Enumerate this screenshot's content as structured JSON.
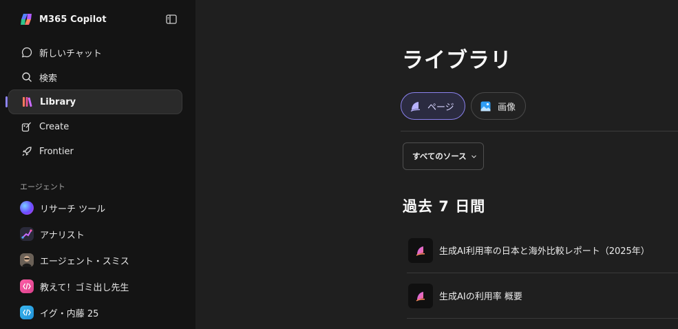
{
  "app": {
    "name": "M365 Copilot"
  },
  "sidebar": {
    "nav": [
      {
        "label": "新しいチャット",
        "icon": "chat-bubble-icon"
      },
      {
        "label": "検索",
        "icon": "search-icon"
      },
      {
        "label": "Library",
        "icon": "library-icon",
        "active": true
      },
      {
        "label": "Create",
        "icon": "create-icon"
      },
      {
        "label": "Frontier",
        "icon": "rocket-icon"
      }
    ],
    "agents_label": "エージェント",
    "agents": [
      {
        "label": "リサーチ ツール",
        "icon": "research-agent-icon"
      },
      {
        "label": "アナリスト",
        "icon": "analyst-agent-icon"
      },
      {
        "label": "エージェント・スミス",
        "icon": "agent-smith-avatar"
      },
      {
        "label": "教えて！ゴミ出し先生",
        "icon": "gomi-agent-icon"
      },
      {
        "label": "イグ・内藤 25",
        "icon": "ig-naito-agent-icon"
      }
    ]
  },
  "main": {
    "title": "ライブラリ",
    "tabs": [
      {
        "label": "ページ",
        "icon": "pages-icon",
        "selected": true
      },
      {
        "label": "画像",
        "icon": "image-icon",
        "selected": false
      }
    ],
    "filter": {
      "label": "すべてのソース"
    },
    "section": "過去 7 日間",
    "documents": [
      {
        "title": "生成AI利用率の日本と海外比較レポート（2025年）"
      },
      {
        "title": "生成AIの利用率 概要"
      }
    ]
  },
  "colors": {
    "accent": "#8f86ff",
    "sidebar_bg": "#141414",
    "main_bg": "#1f1f1f"
  }
}
